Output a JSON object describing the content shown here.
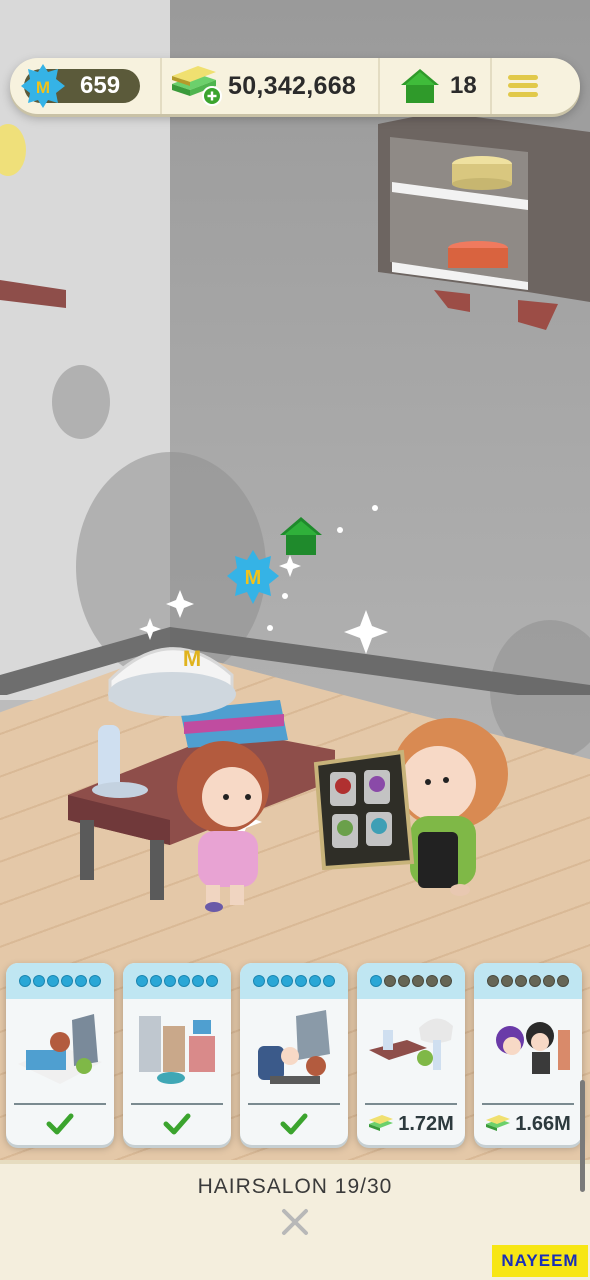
{
  "hud": {
    "stars": "659",
    "cash": "50,342,668",
    "houses": "18"
  },
  "cards": [
    {
      "dots_on": 6,
      "dots_total": 6,
      "owned": true,
      "price": ""
    },
    {
      "dots_on": 6,
      "dots_total": 6,
      "owned": true,
      "price": ""
    },
    {
      "dots_on": 6,
      "dots_total": 6,
      "owned": true,
      "price": ""
    },
    {
      "dots_on": 1,
      "dots_total": 6,
      "owned": false,
      "price": "1.72M"
    },
    {
      "dots_on": 0,
      "dots_total": 6,
      "owned": false,
      "price": "1.66M"
    }
  ],
  "panel": {
    "title": "HAIRSALON 19/30"
  },
  "watermark": "NAYEEM",
  "colors": {
    "accent_blue": "#2aa7d6",
    "check_green": "#3ba42e",
    "house_green": "#2f9a2a",
    "menu_yellow": "#e1c94a"
  }
}
